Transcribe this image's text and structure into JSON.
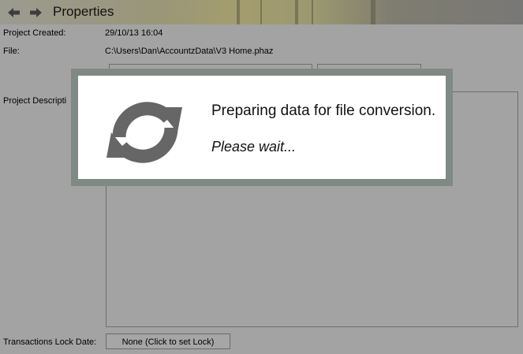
{
  "header": {
    "title": "Properties",
    "back_icon": "arrow-left-icon",
    "forward_icon": "arrow-right-icon"
  },
  "properties": {
    "project_created_label": "Project Created:",
    "project_created_value": "29/10/13 16:04",
    "file_label": "File:",
    "file_value": "C:\\Users\\Dan\\AccountzData\\V3 Home.phaz",
    "project_description_label": "Project Descripti"
  },
  "footer": {
    "lock_date_label": "Transactions Lock Date:",
    "lock_button_label": "None (Click to set Lock)"
  },
  "modal": {
    "message": "Preparing data for file conversion.",
    "submessage": "Please wait...",
    "icon": "refresh-icon"
  },
  "colors": {
    "overlay": "#a3a3a3",
    "modal_frame": "#7f8a84",
    "spinner": "#666666"
  }
}
